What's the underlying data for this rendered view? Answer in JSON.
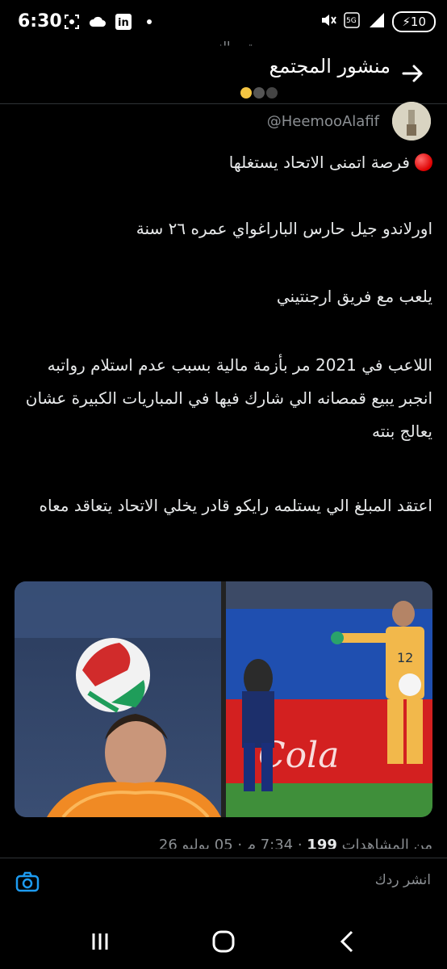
{
  "status": {
    "time": "6:30",
    "battery": "10",
    "network": "5G"
  },
  "header": {
    "title": "منشور المجتمع",
    "subtitle": "مجتمع النصير"
  },
  "author": {
    "handle": "@HeemooAlafif"
  },
  "tweet": {
    "p1": "فرصة اتمنى الاتحاد يستغلها",
    "p2": "اورلاندو جيل حارس الباراغواي عمره ٢٦ سنة",
    "p3": "يلعب مع فريق ارجنتيني",
    "p4": "اللاعب في 2021 مر بأزمة مالية بسبب عدم استلام رواتبه انجبر يبيع قمصانه الي شارك فيها في المباريات الكبيرة عشان يعالج بنته",
    "p5": "اعتقد المبلغ الي يستلمه رايكو قادر يخلي الاتحاد يتعاقد معاه"
  },
  "meta": {
    "time": "7:34 م",
    "date": "05 يوليو 26",
    "views_count": "199",
    "views_label": "من المشاهدات"
  },
  "reply": {
    "placeholder": "انشر ردك"
  },
  "colors": {
    "background": "#000000",
    "accent": "#1d9bf0",
    "text_secondary": "#8b8f93"
  }
}
